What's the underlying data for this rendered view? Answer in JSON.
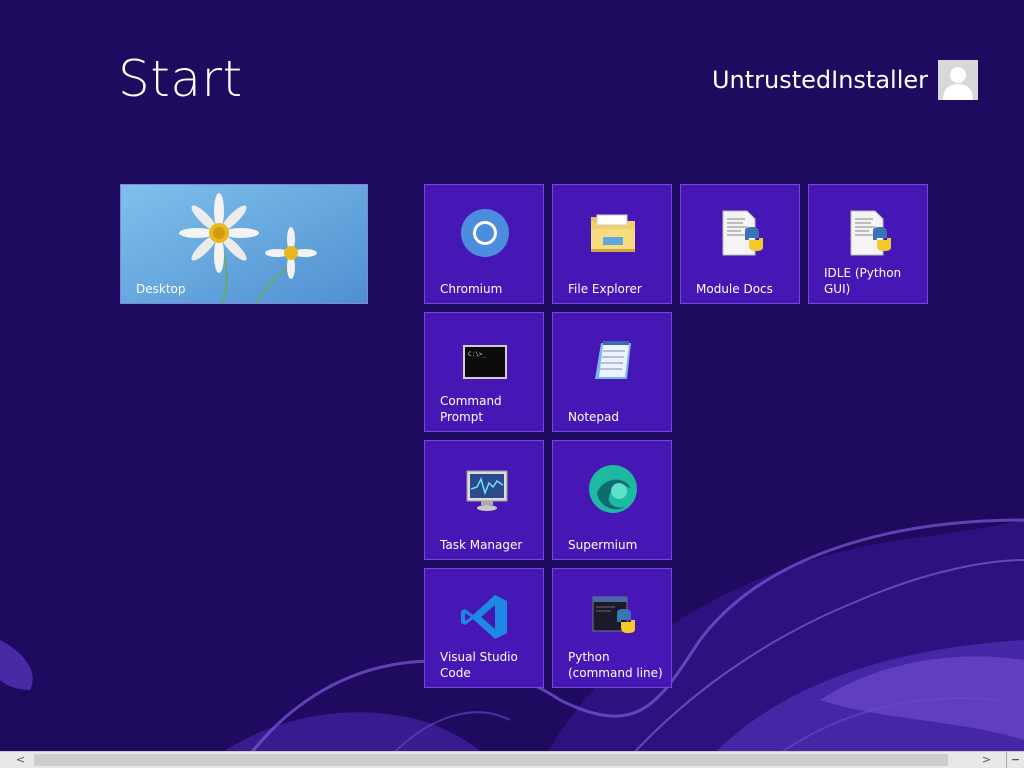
{
  "screen": {
    "title": "Start",
    "user_name": "UntrustedInstaller"
  },
  "tiles": [
    {
      "label": "Desktop",
      "icon": "desktop-wallpaper"
    },
    {
      "label": "Chromium",
      "icon": "chromium-icon"
    },
    {
      "label": "File Explorer",
      "icon": "folder-icon"
    },
    {
      "label": "Module Docs",
      "icon": "python-doc-icon"
    },
    {
      "label": "IDLE (Python GUI)",
      "icon": "python-doc-icon"
    },
    {
      "label": "Command Prompt",
      "icon": "command-prompt-icon"
    },
    {
      "label": "Notepad",
      "icon": "notepad-icon"
    },
    {
      "label": "Task Manager",
      "icon": "task-manager-icon"
    },
    {
      "label": "Supermium",
      "icon": "supermium-icon"
    },
    {
      "label": "Visual Studio Code",
      "icon": "vscode-icon"
    },
    {
      "label": "Python (command line)",
      "icon": "python-console-icon"
    }
  ],
  "colors": {
    "background": "#1e0a5e",
    "tile": "#4617b4",
    "desktop_tile": "#6aa9dc"
  },
  "scrollbar": {
    "left_arrow": "<",
    "right_arrow": ">",
    "menu_glyph": "−"
  }
}
